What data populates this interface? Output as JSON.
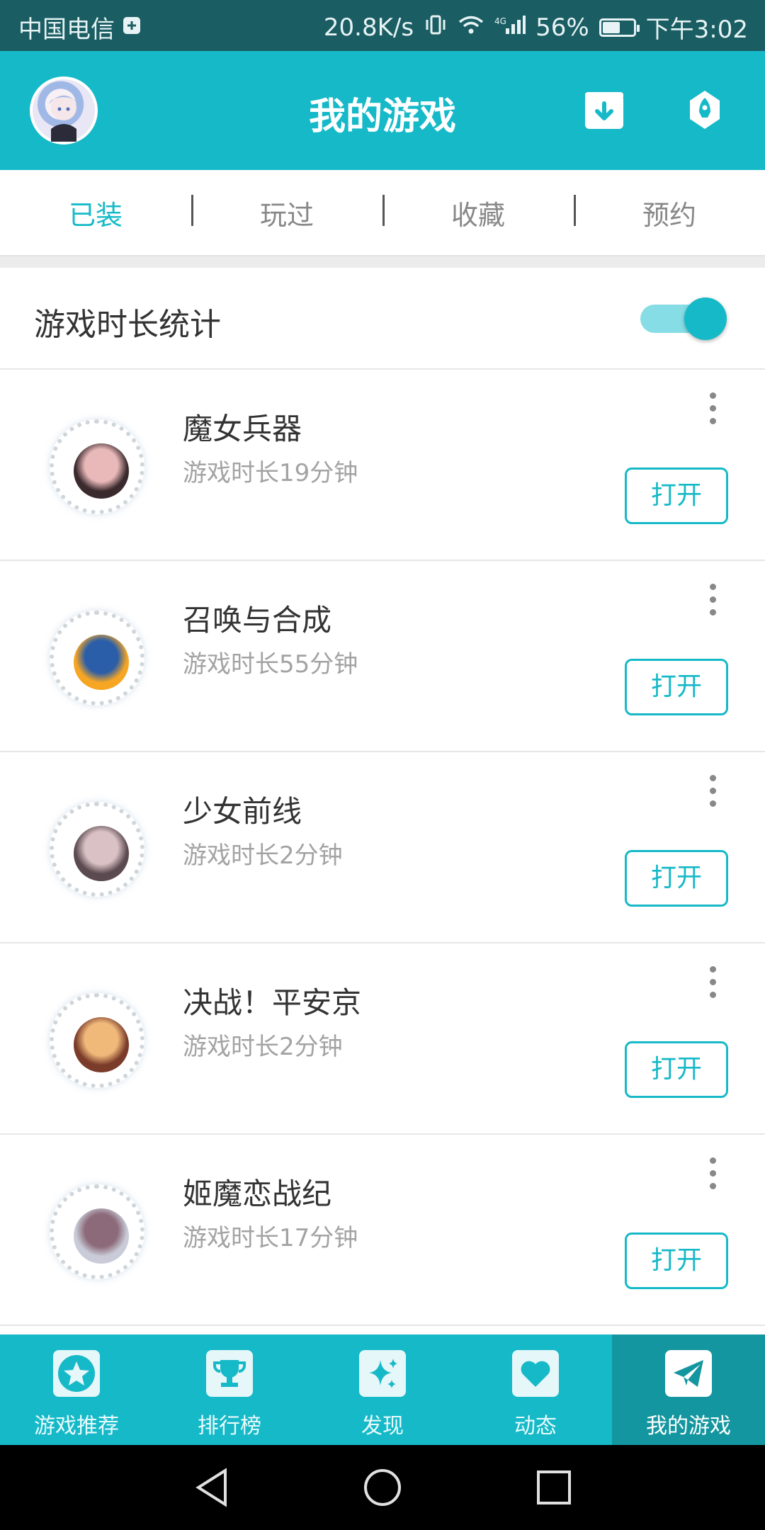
{
  "status_bar": {
    "carrier": "中国电信",
    "speed": "20.8K/s",
    "network": "4G",
    "battery_text": "56%",
    "battery_level": 0.56,
    "time": "下午3:02"
  },
  "header": {
    "title": "我的游戏",
    "avatar_icon": "user-avatar",
    "download_icon": "download-icon",
    "rocket_icon": "rocket-icon",
    "accent_color": "#16b9c8"
  },
  "tabs": [
    {
      "label": "已装",
      "active": true
    },
    {
      "label": "玩过",
      "active": false
    },
    {
      "label": "收藏",
      "active": false
    },
    {
      "label": "预约",
      "active": false
    }
  ],
  "stats": {
    "label": "游戏时长统计",
    "enabled": true
  },
  "games": [
    {
      "name": "魔女兵器",
      "time": "游戏时长19分钟",
      "button": "打开",
      "icon_colors": [
        "#3a2a2e",
        "#e9b8b8"
      ]
    },
    {
      "name": "召唤与合成",
      "time": "游戏时长55分钟",
      "button": "打开",
      "icon_colors": [
        "#f6a623",
        "#2b5ea8"
      ]
    },
    {
      "name": "少女前线",
      "time": "游戏时长2分钟",
      "button": "打开",
      "icon_colors": [
        "#5b4a4f",
        "#d9c1c5"
      ]
    },
    {
      "name": "决战！平安京",
      "time": "游戏时长2分钟",
      "button": "打开",
      "icon_colors": [
        "#7a3b2a",
        "#f0b97a"
      ]
    },
    {
      "name": "姬魔恋战纪",
      "time": "游戏时长17分钟",
      "button": "打开",
      "icon_colors": [
        "#c9ccd8",
        "#8d6a7a"
      ]
    }
  ],
  "bottom_nav": [
    {
      "label": "游戏推荐",
      "icon": "star-icon",
      "active": false
    },
    {
      "label": "排行榜",
      "icon": "trophy-icon",
      "active": false
    },
    {
      "label": "发现",
      "icon": "sparkle-icon",
      "active": false
    },
    {
      "label": "动态",
      "icon": "heart-icon",
      "active": false
    },
    {
      "label": "我的游戏",
      "icon": "paper-plane-icon",
      "active": true
    }
  ]
}
